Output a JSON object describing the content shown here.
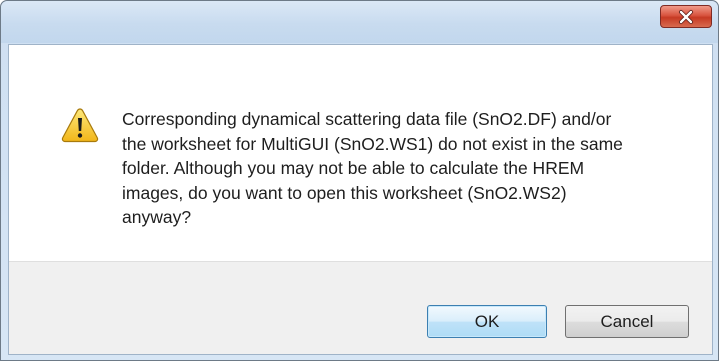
{
  "window": {
    "title": ""
  },
  "message": {
    "text": "Corresponding dynamical scattering data file (SnO2.DF)  and/or\nthe worksheet for MultiGUI (SnO2.WS1) do not exist in the same\nfolder. Although you may not be able to calculate the HREM\nimages, do you want to open this worksheet (SnO2.WS2)\nanyway?"
  },
  "buttons": {
    "ok_label": "OK",
    "cancel_label": "Cancel"
  },
  "icons": {
    "warning": "warning-icon",
    "close": "close-icon"
  },
  "colors": {
    "close_button": "#c63a23",
    "warning_fill": "#f7c531",
    "default_button_border": "#3c7fb1",
    "footer_background": "#f0f0f0"
  }
}
